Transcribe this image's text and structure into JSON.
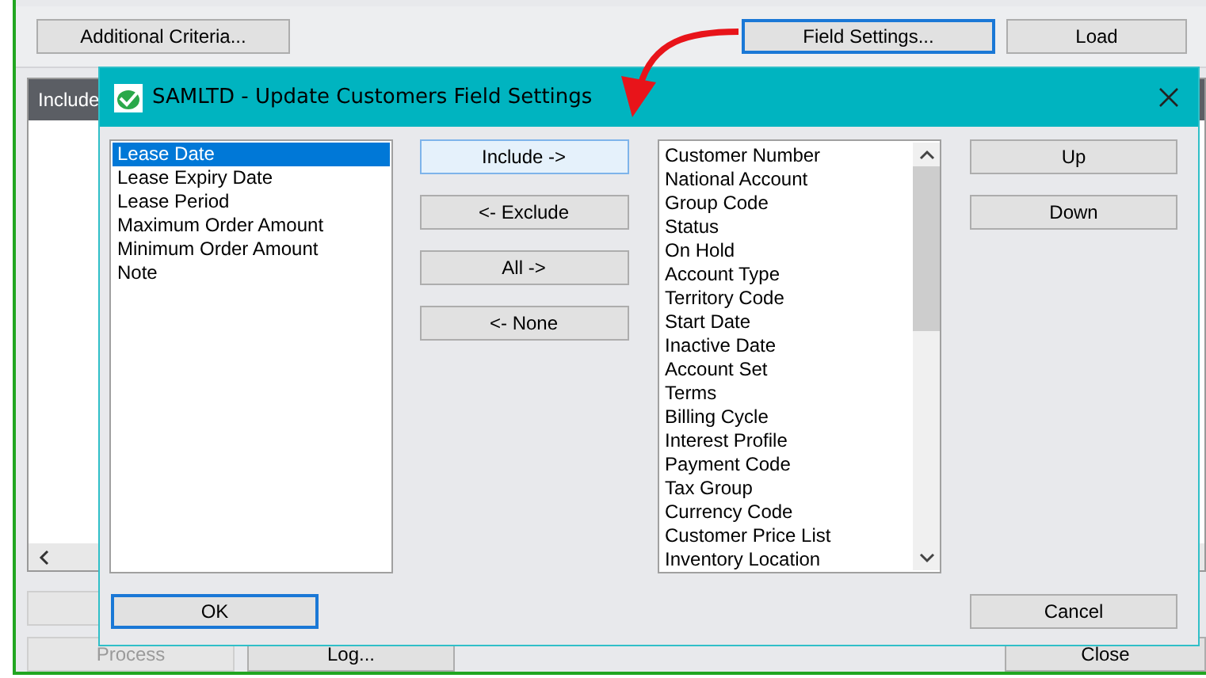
{
  "main_window": {
    "top_buttons": [
      {
        "label": "Additional Criteria...",
        "focused": false
      },
      {
        "label": "Field Settings...",
        "focused": true
      },
      {
        "label": "Load",
        "focused": false
      }
    ],
    "grid": {
      "header": "Include"
    },
    "bottom_buttons": [
      {
        "label": "Process",
        "disabled": true
      },
      {
        "label": "Log...",
        "disabled": false
      },
      {
        "label": "Close",
        "disabled": false
      }
    ]
  },
  "dialog": {
    "title": "SAMLTD - Update Customers Field Settings",
    "available_fields": [
      {
        "label": "Lease Date",
        "selected": true
      },
      {
        "label": "Lease Expiry Date",
        "selected": false
      },
      {
        "label": "Lease Period",
        "selected": false
      },
      {
        "label": "Maximum Order Amount",
        "selected": false
      },
      {
        "label": "Minimum Order Amount",
        "selected": false
      },
      {
        "label": "Note",
        "selected": false
      }
    ],
    "move_buttons": [
      {
        "label": "Include ->",
        "focused": true
      },
      {
        "label": "<- Exclude",
        "focused": false
      },
      {
        "label": "All ->",
        "focused": false
      },
      {
        "label": "<- None",
        "focused": false
      }
    ],
    "included_fields": [
      "Customer Number",
      "National Account",
      "Group Code",
      "Status",
      "On Hold",
      "Account Type",
      "Territory Code",
      "Start Date",
      "Inactive Date",
      "Account Set",
      "Terms",
      "Billing Cycle",
      "Interest Profile",
      "Payment Code",
      "Tax Group",
      "Currency Code",
      "Customer Price List",
      "Inventory Location"
    ],
    "order_buttons": [
      "Up",
      "Down"
    ],
    "ok_button": "OK",
    "cancel_button": "Cancel"
  }
}
